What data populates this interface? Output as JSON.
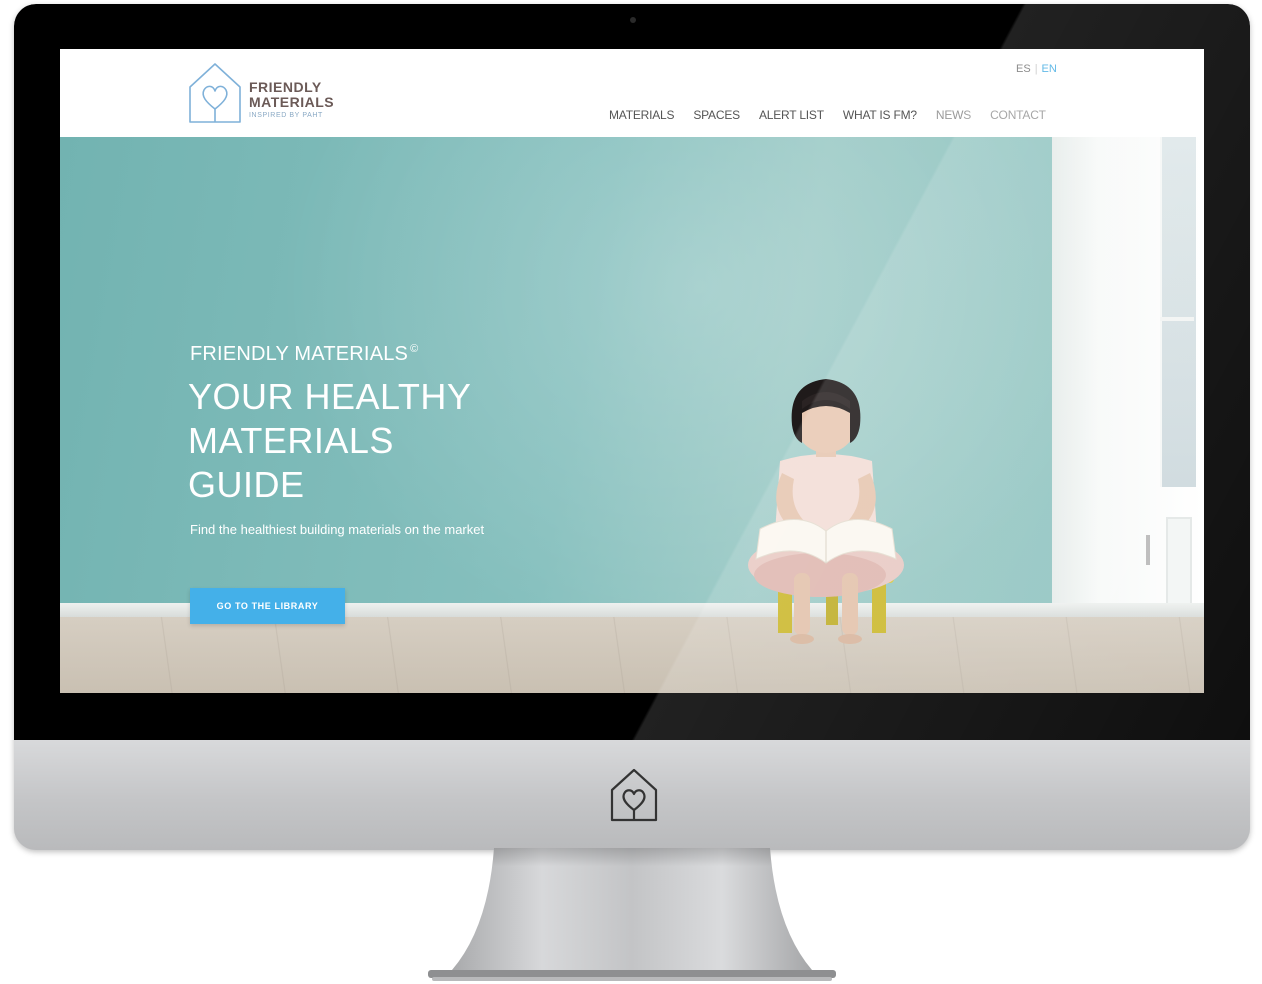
{
  "header": {
    "logo_line1": "FRIENDLY",
    "logo_line2": "MATERIALS",
    "logo_tagline": "INSPIRED BY PAHT",
    "lang_es": "ES",
    "lang_separator": "|",
    "lang_en": "EN"
  },
  "nav": {
    "items": [
      {
        "label": "MATERIALS"
      },
      {
        "label": "SPACES"
      },
      {
        "label": "ALERT LIST"
      },
      {
        "label": "WHAT IS FM?"
      },
      {
        "label": "NEWS"
      },
      {
        "label": "CONTACT"
      }
    ]
  },
  "hero": {
    "kicker": "FRIENDLY MATERIALS",
    "kicker_mark": "©",
    "title": "YOUR HEALTHY MATERIALS GUIDE",
    "subtitle": "Find the healthiest building materials on the market",
    "button_label": "GO TO THE LIBRARY"
  },
  "colors": {
    "accent_blue": "#44b0e9",
    "wall_teal": "#86c0be",
    "logo_text": "#6b5a57",
    "nav_text": "#555555"
  },
  "icons": {
    "logo": "house-heart-icon",
    "chin_logo": "house-heart-icon"
  }
}
